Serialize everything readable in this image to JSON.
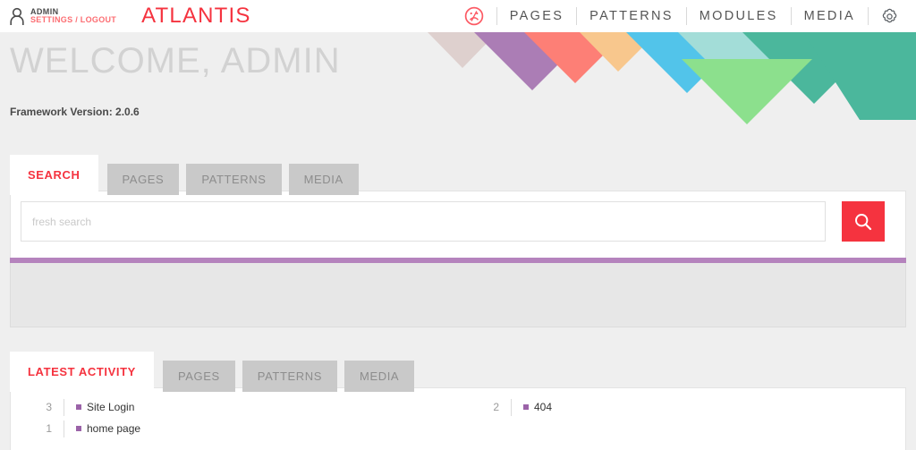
{
  "topbar": {
    "user_icon": "user-icon",
    "user_name": "ADMIN",
    "user_links": "SETTINGS / LOGOUT",
    "brand": "ATLANTIS",
    "gauge_icon": "gauge-icon",
    "gear_icon": "gear-icon",
    "nav_items": [
      {
        "label": "PAGES"
      },
      {
        "label": "PATTERNS"
      },
      {
        "label": "MODULES"
      },
      {
        "label": "MEDIA"
      }
    ]
  },
  "hero": {
    "colors": [
      "#ded0ce",
      "#ab7db5",
      "#fd7f76",
      "#f8c78d",
      "#52c4ea",
      "#a3ddd8",
      "#4bb79c",
      "#8ce08d"
    ]
  },
  "main": {
    "welcome_title": "WELCOME, ADMIN",
    "framework_version": "Framework Version: 2.0.6"
  },
  "search": {
    "tabs": [
      {
        "label": "SEARCH",
        "active": true
      },
      {
        "label": "PAGES",
        "active": false
      },
      {
        "label": "PATTERNS",
        "active": false
      },
      {
        "label": "MEDIA",
        "active": false
      }
    ],
    "placeholder": "fresh search",
    "value": "",
    "search_icon": "magnifier-icon",
    "accent_color": "#b583bd",
    "button_color": "#f5333f"
  },
  "activity": {
    "tabs": [
      {
        "label": "LATEST ACTIVITY",
        "active": true
      },
      {
        "label": "PAGES",
        "active": false
      },
      {
        "label": "PATTERNS",
        "active": false
      },
      {
        "label": "MEDIA",
        "active": false
      }
    ],
    "columns": [
      {
        "rows": [
          {
            "count": "3",
            "label": "Site Login"
          },
          {
            "count": "1",
            "label": "home page"
          }
        ]
      },
      {
        "rows": [
          {
            "count": "2",
            "label": "404"
          }
        ]
      }
    ]
  }
}
